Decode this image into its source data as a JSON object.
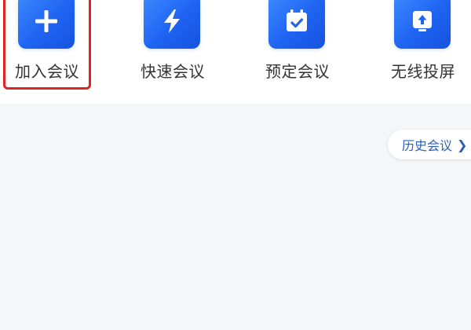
{
  "actions": [
    {
      "label": "加入会议",
      "icon": "plus-icon"
    },
    {
      "label": "快速会议",
      "icon": "lightning-icon"
    },
    {
      "label": "预定会议",
      "icon": "calendar-check-icon"
    },
    {
      "label": "无线投屏",
      "icon": "screen-cast-icon"
    }
  ],
  "history": {
    "label": "历史会议",
    "chevron": "chevron-right-icon"
  },
  "colors": {
    "accent": "#1f63f2",
    "highlight": "#e02323",
    "link": "#2b5fb8",
    "background": "#f5f6f8"
  }
}
